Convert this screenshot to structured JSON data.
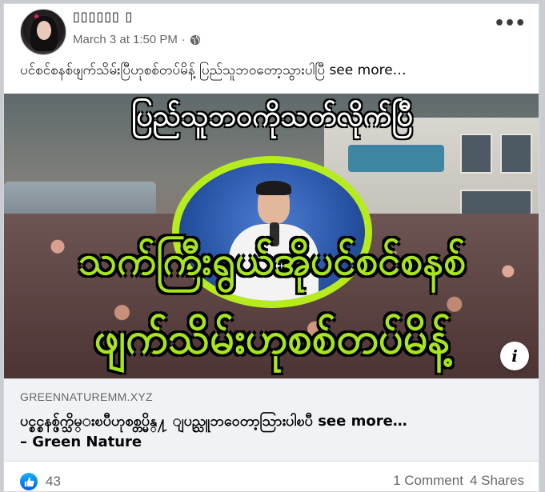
{
  "post": {
    "author": "▯▯▯▯▯▯ ▯",
    "timestamp": "March 3 at 1:50 PM",
    "separator": "·",
    "privacy_icon": "globe-icon",
    "text": "ပင်စင်စနစ်ဖျက်သိမ်းပြီဟုစစ်တပ်မိန့် ပြည်သူဘဝတော့သွားပါပြီ see more…"
  },
  "image": {
    "headline_top": "ပြည်သူဘဝကိုသတ်လိုက်ပြီ",
    "headline_middle": "သက်ကြီးရွယ်အိုပင်စင်စနစ်",
    "headline_bottom": "ဖျက်သိမ်းဟုစစ်တပ်မိန့်",
    "info_icon": "i"
  },
  "link_preview": {
    "domain": "GREENNATUREMM.XYZ",
    "title_line1": "ပင္စင္စနစ္ဖ်က္သိမ္းၿပီဟုစစ္တပ္မိန္႔ ျပည္သူဘဝေတာ့သြားပါၿပီ see more…",
    "title_line2": "– Green Nature"
  },
  "footer": {
    "reaction_icon": "like-icon",
    "reaction_count": "43",
    "comments": "1 Comment",
    "shares": "4 Shares"
  },
  "colors": {
    "accent_blue": "#1877f2",
    "headline_green": "#a7e51d",
    "oval_border": "#b6ec1d",
    "link_bg": "#f0f2f5",
    "meta_gray": "#65676b"
  }
}
